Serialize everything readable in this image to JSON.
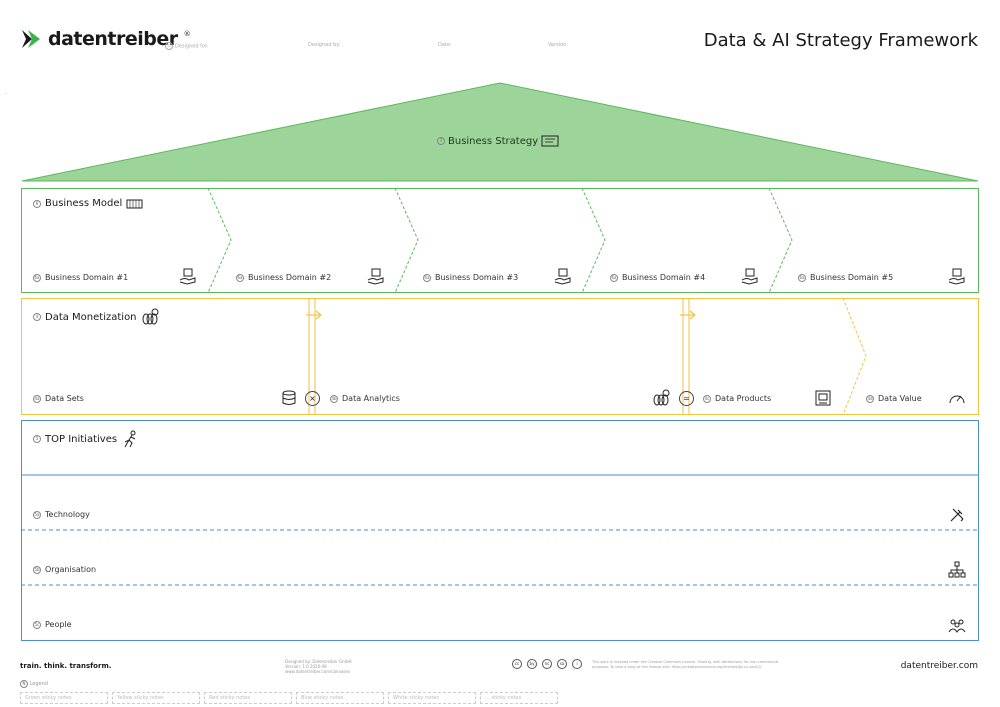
{
  "header": {
    "brand": "datentreiber",
    "brand_mark": "®",
    "designed_for": "Designed for:",
    "designed_by": "Designed by:",
    "date": "Date:",
    "version": "Version:",
    "title": "Data & AI Strategy Framework"
  },
  "roof": {
    "num": "7",
    "label": "Business Strategy"
  },
  "business_model": {
    "num": "6",
    "title": "Business Model",
    "domains": [
      "Business Domain #1",
      "Business Domain #2",
      "Business Domain #3",
      "Business Domain #4",
      "Business Domain #5"
    ],
    "domain_num": "6a"
  },
  "data_monetization": {
    "num": "4",
    "title": "Data Monetization",
    "items": [
      {
        "num": "4a",
        "label": "Data Sets"
      },
      {
        "num": "4b",
        "label": "Data Analytics"
      },
      {
        "num": "4c",
        "label": "Data Products"
      },
      {
        "num": "4d",
        "label": "Data Value"
      }
    ],
    "op_multiply": "×",
    "op_equals": "="
  },
  "initiatives": {
    "num": "5",
    "title": "TOP Initiatives",
    "rows": [
      {
        "num": "5a",
        "label": "Technology"
      },
      {
        "num": "5b",
        "label": "Organisation"
      },
      {
        "num": "5c",
        "label": "People"
      }
    ]
  },
  "footer": {
    "tagline": "train. think. transform.",
    "credits": [
      "Designed by: Datentreiber GmbH",
      "Version: 1.0 2020-09",
      "www.datentreiber.com/canvases"
    ],
    "license": [
      "cc",
      "by",
      "nc",
      "sa",
      "i"
    ],
    "license_text": "This work is licensed under the Creative Commons License. Sharing, with attributions, for non-commercial purposes. To view a copy of this license visit: https://creativecommons.org/licenses/by-nc-sa/4.0/",
    "site": "datentreiber.com",
    "legend_num": "N",
    "legend_title": "Legend",
    "stickies": [
      "Green sticky notes",
      "Yellow sticky notes",
      "Red sticky notes",
      "Blue sticky notes",
      "White sticky notes",
      "... sticky notes"
    ]
  },
  "colors": {
    "green": "#5cb85c",
    "green_fill": "#9dd49a",
    "yellow": "#f5c242",
    "blue": "#4a8fd1"
  }
}
